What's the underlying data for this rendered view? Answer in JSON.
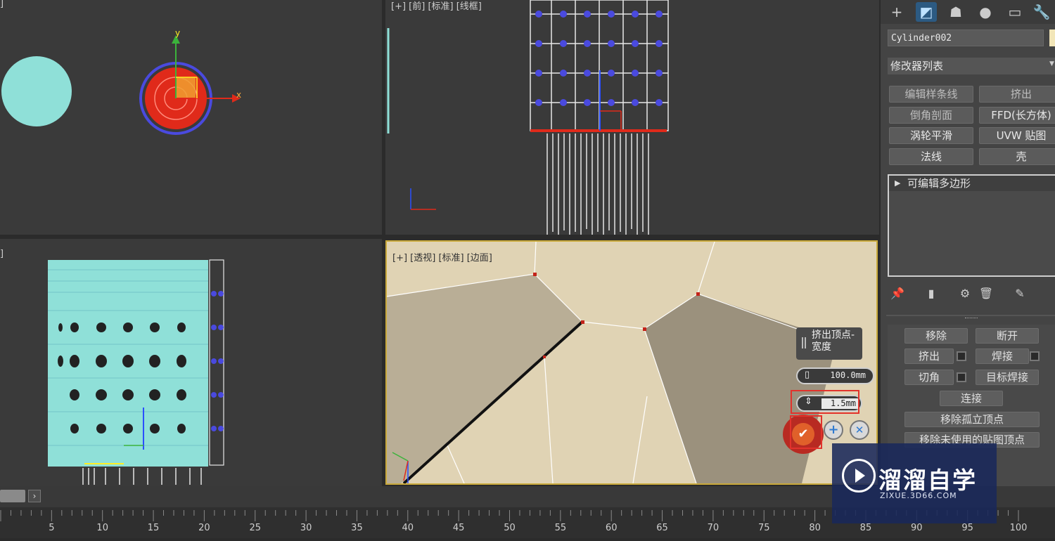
{
  "viewports": {
    "top": {
      "label": "]"
    },
    "front": {
      "label": "[+] [前] [标准] [线框]"
    },
    "left": {
      "label": "]"
    },
    "perspective": {
      "label": "[+] [透视] [标准] [边面]"
    }
  },
  "axes": {
    "x": "x",
    "y": "y",
    "z": "z"
  },
  "command_panel": {
    "tabs": [
      {
        "icon": "create-icon",
        "active": false
      },
      {
        "icon": "modify-icon",
        "active": true
      },
      {
        "icon": "hierarchy-icon",
        "active": false
      },
      {
        "icon": "motion-icon",
        "active": false
      },
      {
        "icon": "display-icon",
        "active": false
      },
      {
        "icon": "utilities-icon",
        "active": false
      }
    ],
    "object_name": "Cylinder002",
    "object_color": "#f2e6b8",
    "modifier_list": "修改器列表",
    "modifier_buttons": [
      "编辑样条线",
      "挤出",
      "倒角剖面",
      "FFD(长方体)",
      "涡轮平滑",
      "UVW 贴图",
      "法线",
      "壳"
    ],
    "stack_item": "可编辑多边形",
    "edit_vertices": {
      "remove": "移除",
      "break": "断开",
      "extrude": "挤出",
      "weld": "焊接",
      "chamfer": "切角",
      "target_weld": "目标焊接",
      "connect": "连接",
      "remove_isolated": "移除孤立顶点",
      "remove_unused_map": "移除未使用的贴图顶点"
    }
  },
  "caddy": {
    "title": "挤出顶点-宽度",
    "height_value": "100.0mm",
    "width_value": "1.5mm"
  },
  "timeline": {
    "ticks": [
      5,
      10,
      15,
      20,
      25,
      30,
      35,
      40,
      45,
      50,
      55,
      60,
      65,
      70,
      75,
      80,
      85,
      90,
      95,
      100
    ]
  },
  "watermark": {
    "title": "溜溜自学",
    "sub": "ZIXUE.3D66.COM"
  },
  "colors": {
    "accent_active_tab": "#2c5a82",
    "selection_red": "#e2332c",
    "vertex_blue": "#4a4adf",
    "mesh_cyan": "#8fe0d8"
  }
}
